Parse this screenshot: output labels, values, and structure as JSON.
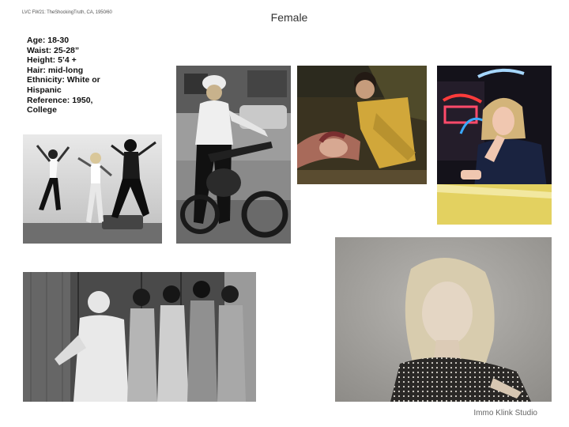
{
  "header_note": "LVC FW21: TheShockingTruth, CA, 1950/60",
  "title": "Female",
  "specs": [
    "Age: 18-30",
    "Waist: 25-28”",
    "Height: 5’4 +",
    "Hair: mid-long",
    "Ethnicity: White or",
    "Hispanic",
    "Reference: 1950,",
    "College"
  ],
  "credit": "Immo Klink Studio",
  "photos": [
    {
      "subject": "three-women-jumping"
    },
    {
      "subject": "woman-on-motorcycle"
    },
    {
      "subject": "couple-in-car"
    },
    {
      "subject": "woman-neon-diner"
    },
    {
      "subject": "gang-of-girls-at-fence"
    },
    {
      "subject": "blonde-woman-portrait"
    }
  ]
}
